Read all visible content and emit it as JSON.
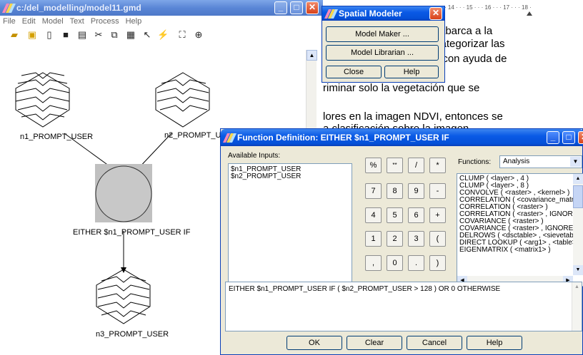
{
  "modeler": {
    "title": "c:/del_modelling/model11.gmd",
    "menu": [
      "File",
      "Edit",
      "Model",
      "Text",
      "Process",
      "Help"
    ],
    "toolbar_icons": [
      "open-icon",
      "open-folder-icon",
      "new-icon",
      "save-icon",
      "print-icon",
      "cut-icon",
      "copy-icon",
      "paste-icon",
      "pointer-icon",
      "run-icon",
      "fit-icon",
      "zoom-icon"
    ],
    "nodes": {
      "n1": "n1_PROMPT_USER",
      "n2": "n2_PROMPT_USER",
      "func": "EITHER $n1_PROMPT_USER IF",
      "n3": "n3_PROMPT_USER"
    }
  },
  "spatial_modeler": {
    "title": "Spatial Modeler",
    "model_maker": "Model Maker ...",
    "model_librarian": "Model Librarian ...",
    "close": "Close",
    "help": "Help"
  },
  "word": {
    "ruler": "· 14 · · · 15 · · · 16 · · · 17 · · · 18 ·",
    "lines": [
      "abarca a la",
      "categorizar las",
      "/ con ayuda de",
      "riminar solo la vegetación que se",
      "lores en la imagen NDVI, entonces se",
      "a clasificación sobre la imagen"
    ]
  },
  "function_def": {
    "title": "Function Definition:  EITHER $n1_PROMPT_USER IF",
    "available_inputs_label": "Available Inputs:",
    "inputs": [
      "$n1_PROMPT_USER",
      "$n2_PROMPT_USER"
    ],
    "keypad": [
      [
        "%",
        "**",
        "/",
        "*"
      ],
      [
        "7",
        "8",
        "9",
        "-"
      ],
      [
        "4",
        "5",
        "6",
        "+"
      ],
      [
        "1",
        "2",
        "3",
        "("
      ],
      [
        ",",
        "0",
        ".",
        ")"
      ]
    ],
    "functions_label": "Functions:",
    "functions_category": "Analysis",
    "functions": [
      "CLUMP ( <layer> , 4 )",
      "CLUMP ( <layer> , 8 )",
      "CONVOLVE ( <raster> , <kernel> )",
      "CORRELATION ( <covariance_matrix",
      "CORRELATION ( <raster> )",
      "CORRELATION ( <raster> , IGNORE -",
      "COVARIANCE ( <raster> )",
      "COVARIANCE ( <raster> , IGNORE <v",
      "DELROWS ( <dsctable> , <sievetable",
      "DIRECT LOOKUP ( <arg1> , <table> )",
      "EIGENMATRIX ( <matrix1> )"
    ],
    "expression": "EITHER $n1_PROMPT_USER IF ( $n2_PROMPT_USER > 128 ) OR 0 OTHERWISE",
    "buttons": {
      "ok": "OK",
      "clear": "Clear",
      "cancel": "Cancel",
      "help": "Help"
    }
  },
  "colors": {
    "xp_blue": "#0a5ae6",
    "dialog_bg": "#ece9d8",
    "node_fill": "#c0c0c0"
  }
}
